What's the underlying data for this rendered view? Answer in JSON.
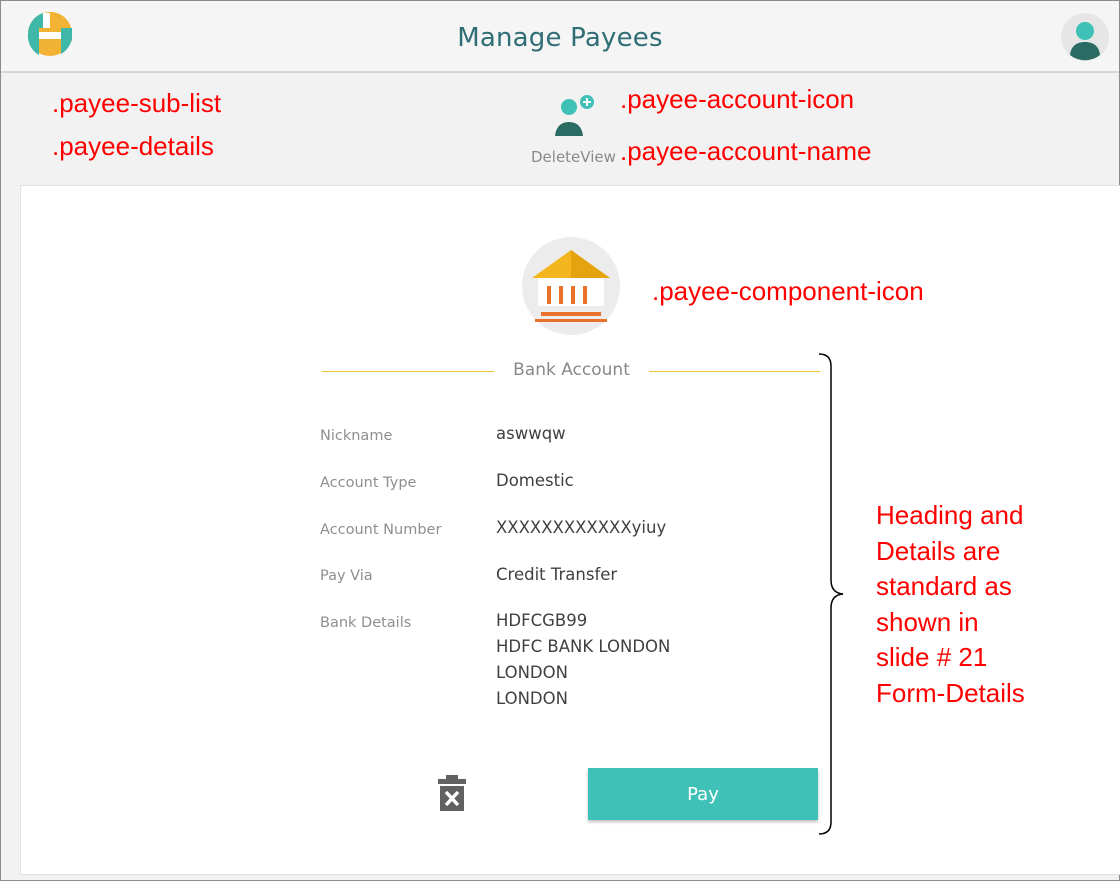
{
  "header": {
    "title": "Manage Payees"
  },
  "annotations": {
    "sub_list": ".payee-sub-list",
    "details": ".payee-details",
    "account_icon": ".payee-account-icon",
    "account_name": ".payee-account-name",
    "component_icon": ".payee-component-icon",
    "note_lines": [
      "Heading and",
      "Details are",
      "standard as",
      "shown in",
      "slide # 21",
      "Form-Details"
    ]
  },
  "payee_account": {
    "name": "DeleteView"
  },
  "section": {
    "heading": "Bank Account"
  },
  "details": [
    {
      "label": "Nickname",
      "value": [
        "aswwqw"
      ]
    },
    {
      "label": "Account Type",
      "value": [
        "Domestic"
      ]
    },
    {
      "label": "Account Number",
      "value": [
        "XXXXXXXXXXXXyiuy"
      ]
    },
    {
      "label": "Pay Via",
      "value": [
        "Credit Transfer"
      ]
    },
    {
      "label": "Bank Details",
      "value": [
        "HDFCGB99",
        "HDFC BANK LONDON",
        "LONDON",
        "LONDON"
      ]
    }
  ],
  "actions": {
    "pay_label": "Pay"
  },
  "icons": {
    "logo": "app-logo-icon",
    "avatar": "user-avatar-icon",
    "account": "add-person-icon",
    "component": "bank-icon",
    "delete": "trash-icon"
  },
  "colors": {
    "brand": "#2f6e74",
    "accent": "#3fc1b8",
    "gold": "#f0c430",
    "annotation": "#ff0000"
  }
}
